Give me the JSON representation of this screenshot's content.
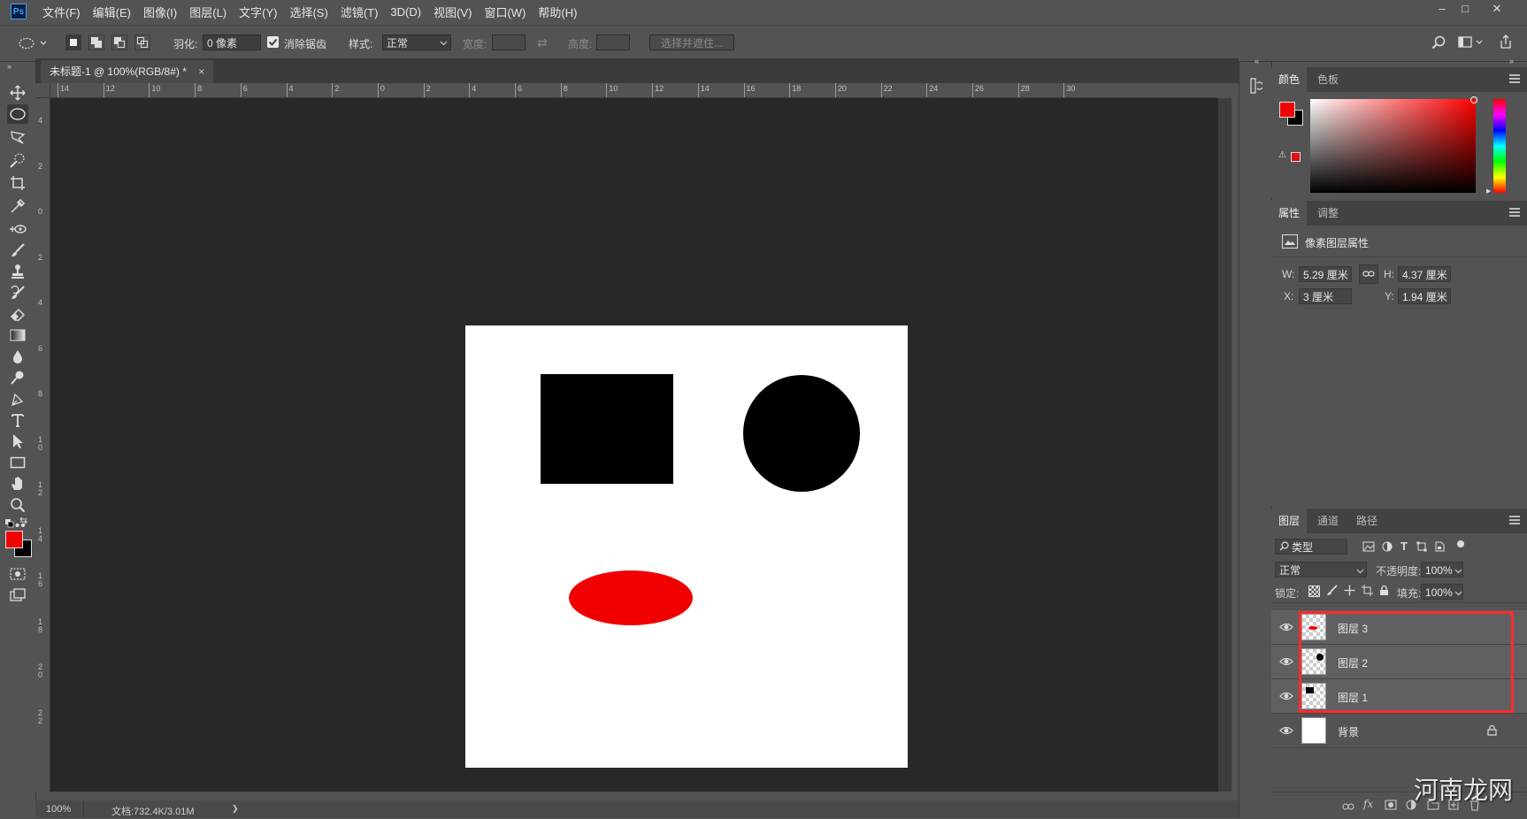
{
  "app": {
    "logo": "Ps"
  },
  "menu": [
    "文件(F)",
    "编辑(E)",
    "图像(I)",
    "图层(L)",
    "文字(Y)",
    "选择(S)",
    "滤镜(T)",
    "3D(D)",
    "视图(V)",
    "窗口(W)",
    "帮助(H)"
  ],
  "window_controls": {
    "minimize": "‒",
    "maximize": "□",
    "close": "✕"
  },
  "options": {
    "feather_label": "羽化:",
    "feather_value": "0 像素",
    "antialias_label": "消除锯齿",
    "antialias_checked": true,
    "style_label": "样式:",
    "style_value": "正常",
    "width_label": "宽度:",
    "height_label": "高度:",
    "select_mask_button": "选择并遮住..."
  },
  "document": {
    "tab_title": "未标题-1 @ 100%(RGB/8#) *",
    "tab_close": "×"
  },
  "rulers": {
    "top": [
      "14",
      "12",
      "10",
      "8",
      "6",
      "4",
      "2",
      "0",
      "2",
      "4",
      "6",
      "8",
      "10",
      "12",
      "14",
      "16",
      "18",
      "20",
      "22",
      "24",
      "26",
      "28",
      "30"
    ],
    "left": [
      "4",
      "2",
      "0",
      "2",
      "4",
      "6",
      "8",
      "1 0",
      "1 2",
      "1 4",
      "1 6",
      "1 8",
      "2 0",
      "2 2"
    ]
  },
  "status": {
    "zoom": "100%",
    "doc_info": "文档:732.4K/3.01M",
    "arrow": "❯"
  },
  "colors": {
    "foreground": "#f00000",
    "background": "#000000",
    "accent_red": "#ff2b2b"
  },
  "color_panel": {
    "tabs": [
      "颜色",
      "色板"
    ]
  },
  "properties_panel": {
    "tabs": [
      "属性",
      "调整"
    ],
    "header": "像素图层属性",
    "w_label": "W:",
    "w_value": "5.29 厘米",
    "h_label": "H:",
    "h_value": "4.37 厘米",
    "x_label": "X:",
    "x_value": "3 厘米",
    "y_label": "Y:",
    "y_value": "1.94 厘米"
  },
  "layers_panel": {
    "tabs": [
      "图层",
      "通道",
      "路径"
    ],
    "filter_label": "类型",
    "blend_mode": "正常",
    "opacity_label": "不透明度:",
    "opacity_value": "100%",
    "lock_label": "锁定:",
    "fill_label": "填充:",
    "fill_value": "100%",
    "layers": [
      {
        "name": "图层 3",
        "thumb": "ellipse-red"
      },
      {
        "name": "图层 2",
        "thumb": "circle-black"
      },
      {
        "name": "图层 1",
        "thumb": "square-black"
      },
      {
        "name": "背景",
        "thumb": "white",
        "locked": true
      }
    ]
  },
  "watermark": "河南龙网"
}
